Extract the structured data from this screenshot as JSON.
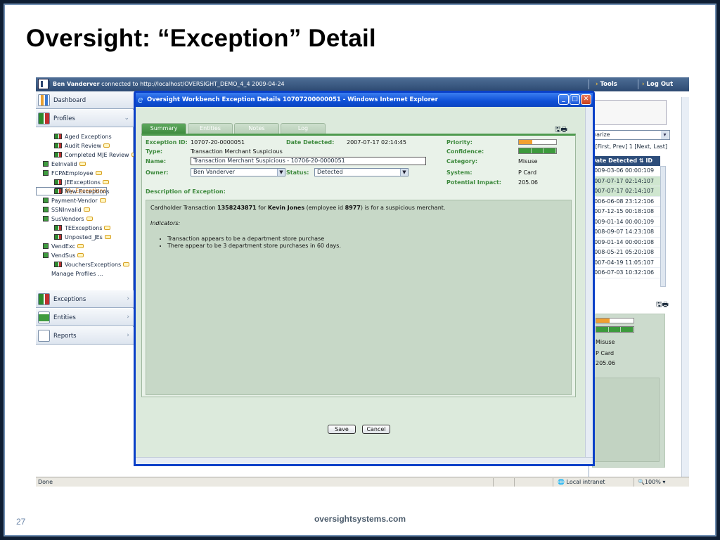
{
  "slide": {
    "title": "Oversight: “Exception” Detail",
    "page_number": "27",
    "footer": "oversightsystems.com"
  },
  "app": {
    "user": "Ben Vanderver",
    "connection_text": "connected to http://localhost/OVERSIGHT_DEMO_4_4  2009-04-24",
    "top_links": [
      "Tools",
      "Log Out"
    ]
  },
  "sidebar": {
    "sections": {
      "dashboard": "Dashboard",
      "profiles": "Profiles",
      "exceptions": "Exceptions",
      "entities": "Entities",
      "reports": "Reports"
    },
    "profiles": [
      {
        "label": "Aged Exceptions",
        "bubble": false,
        "selected": false,
        "sub": true
      },
      {
        "label": "Audit Review",
        "bubble": true,
        "selected": false,
        "sub": true
      },
      {
        "label": "Completed MJE Review",
        "bubble": true,
        "selected": false,
        "sub": true
      },
      {
        "label": "EeInvalid",
        "bubble": true,
        "selected": false,
        "sub": false
      },
      {
        "label": "FCPAEmployee",
        "bubble": true,
        "selected": false,
        "sub": false
      },
      {
        "label": "JEExceptions",
        "bubble": true,
        "selected": false,
        "sub": true
      },
      {
        "label": "My Exceptions",
        "bubble": false,
        "selected": true,
        "sub": true
      },
      {
        "label": "New Exceptions",
        "bubble": false,
        "selected": false,
        "sub": true
      },
      {
        "label": "Payment-Vendor",
        "bubble": true,
        "selected": false,
        "sub": false
      },
      {
        "label": "SSNInvalid",
        "bubble": true,
        "selected": false,
        "sub": false
      },
      {
        "label": "SusVendors",
        "bubble": true,
        "selected": false,
        "sub": false
      },
      {
        "label": "TEExceptions",
        "bubble": true,
        "selected": false,
        "sub": true
      },
      {
        "label": "Unposted_JEs",
        "bubble": true,
        "selected": false,
        "sub": true
      },
      {
        "label": "VendExc",
        "bubble": true,
        "selected": false,
        "sub": false
      },
      {
        "label": "VendSus",
        "bubble": true,
        "selected": false,
        "sub": false
      },
      {
        "label": "VouchersExceptions",
        "bubble": true,
        "selected": false,
        "sub": true
      }
    ],
    "manage_profiles": "Manage Profiles ..."
  },
  "right_panel": {
    "select_value": "narize",
    "pager": "2 [First, Prev] 1 [Next, Last]",
    "columns": [
      "Date Detected",
      "ID"
    ],
    "rows": [
      "2009-03-06 00:00:109",
      "2007-07-17 02:14:107",
      "2007-07-17 02:14:107",
      "2006-06-08 23:12:106",
      "2007-12-15 00:18:108",
      "2009-01-14 00:00:109",
      "2008-09-07 14:23:108",
      "2009-01-14 00:00:108",
      "2008-05-21 05:20:108",
      "2007-04-19 11:05:107",
      "2006-07-03 10:32:106"
    ],
    "highlighted_rows": [
      1,
      2
    ],
    "lower_values": [
      "Misuse",
      "P Card",
      "205.06"
    ]
  },
  "statusbar": {
    "left": "Done",
    "zone": "Local intranet",
    "zoom": "100%"
  },
  "dialog": {
    "title": "Oversight Workbench Exception Details 10707200000051 - Windows Internet Explorer",
    "tabs": [
      "Summary",
      "Entities",
      "Notes",
      "Log"
    ],
    "active_tab": 0,
    "labels": {
      "exception_id": "Exception ID:",
      "type": "Type:",
      "name": "Name:",
      "owner": "Owner:",
      "status": "Status:",
      "date_detected": "Date Detected:",
      "priority": "Priority:",
      "confidence": "Confidence:",
      "category": "Category:",
      "system": "System:",
      "potential_impact": "Potential Impact:",
      "description": "Description of Exception:"
    },
    "values": {
      "exception_id": "10707-20-0000051",
      "type": "Transaction Merchant Suspicious",
      "name": "Transaction Merchant Suspicious - 10706-20-0000051",
      "owner": "Ben Vanderver",
      "status": "Detected",
      "date_detected": "2007-07-17 02:14:45",
      "category": "Misuse",
      "system": "P Card",
      "potential_impact": "205.06"
    },
    "priority_level": 0.35,
    "confidence_level": 3,
    "confidence_max": 3,
    "description": {
      "pre": "Cardholder Transaction ",
      "txn": "1358243871",
      "mid1": " for ",
      "person": "Kevin Jones",
      "mid2": " (employee id ",
      "emp_id": "8977",
      "post": ") is for a suspicious merchant.",
      "indicators_label": "Indicators:",
      "indicators": [
        "Transaction appears to be a department store purchase",
        "There appear to be 3 department store purchases in 60 days."
      ]
    },
    "buttons": {
      "save": "Save",
      "cancel": "Cancel"
    }
  },
  "colors": {
    "slide_frame": "#0e1e33",
    "accent_green": "#3e8a3e",
    "title_bar_blue": "#0d4fd6",
    "priority_orange": "#f0a030"
  }
}
